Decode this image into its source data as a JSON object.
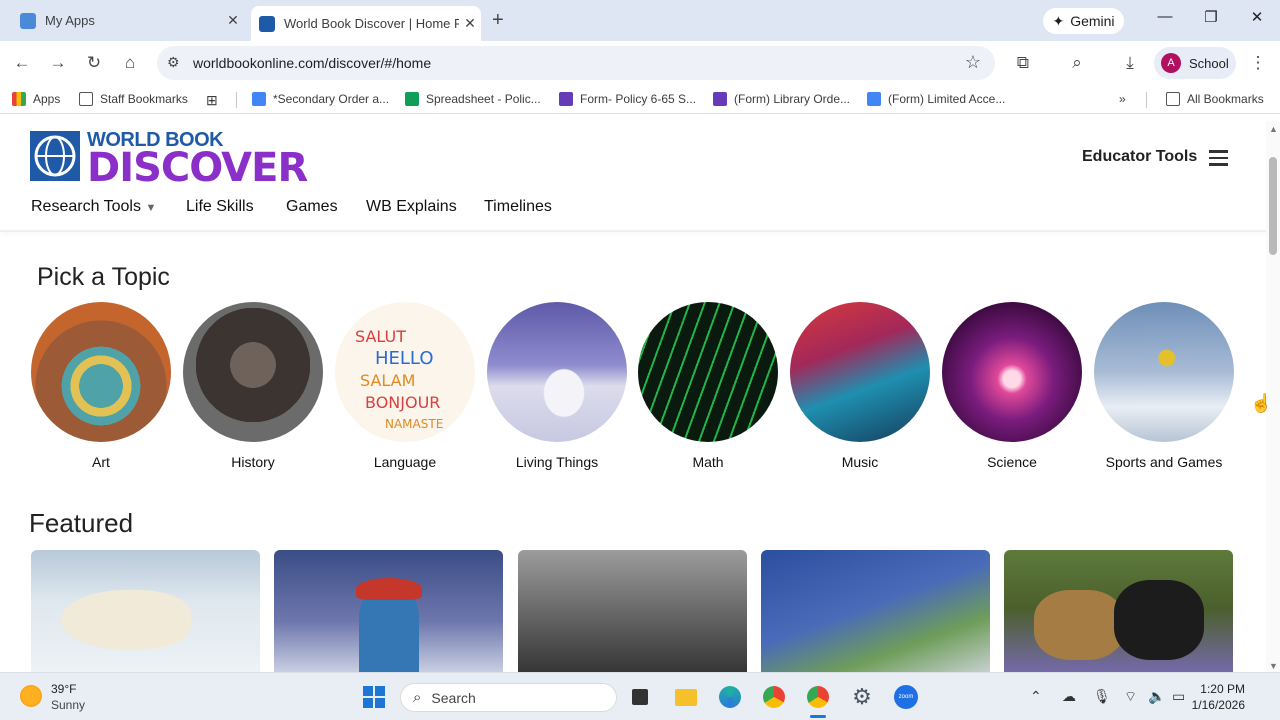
{
  "browser": {
    "tabs": [
      {
        "title": "My Apps",
        "active": false,
        "favicon_color": "#4a8ad8"
      },
      {
        "title": "World Book Discover | Home Pa",
        "active": true,
        "favicon_color": "#1e5aa8"
      }
    ],
    "gemini_label": "Gemini",
    "url": "worldbookonline.com/discover/#/home",
    "profile_initial": "A",
    "profile_label": "School"
  },
  "bookmarks": [
    {
      "label": "Apps",
      "icon": "apps-grid-icon",
      "color": "#ea4335"
    },
    {
      "label": "Staff Bookmarks",
      "icon": "folder-icon",
      "color": "#555555"
    },
    {
      "label": "*Secondary Order a...",
      "icon": "docs-icon",
      "color": "#4285f4"
    },
    {
      "label": "Spreadsheet - Polic...",
      "icon": "sheets-icon",
      "color": "#0f9d58"
    },
    {
      "label": "Form- Policy 6-65 S...",
      "icon": "forms-icon",
      "color": "#673ab7"
    },
    {
      "label": "(Form) Library Orde...",
      "icon": "forms-icon",
      "color": "#673ab7"
    },
    {
      "label": "(Form) Limited Acce...",
      "icon": "docs-icon",
      "color": "#4285f4"
    }
  ],
  "all_bookmarks_label": "All Bookmarks",
  "site": {
    "logo_top": "WORLD BOOK",
    "logo_main": "DISCOVER",
    "educator_tools": "Educator Tools",
    "nav": [
      "Research Tools",
      "Life Skills",
      "Games",
      "WB Explains",
      "Timelines"
    ],
    "pick_heading": "Pick a Topic",
    "topics": [
      "Art",
      "History",
      "Language",
      "Living Things",
      "Math",
      "Music",
      "Science",
      "Sports and Games"
    ],
    "featured_heading": "Featured"
  },
  "taskbar": {
    "temperature": "39°F",
    "condition": "Sunny",
    "search_placeholder": "Search",
    "time": "1:20 PM",
    "date": "1/16/2026"
  }
}
